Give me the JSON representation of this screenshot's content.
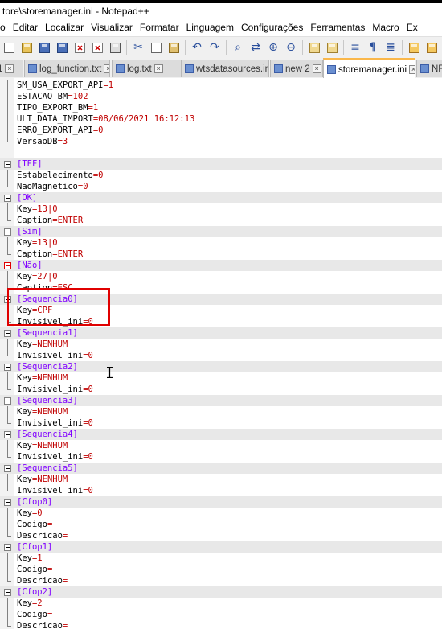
{
  "window": {
    "title": "tore\\storemanager.ini - Notepad++"
  },
  "menu": [
    "o",
    "Editar",
    "Localizar",
    "Visualizar",
    "Formatar",
    "Linguagem",
    "Configurações",
    "Ferramentas",
    "Macro",
    "Ex"
  ],
  "toolbar_icons": [
    "new-file-icon",
    "open-file-icon",
    "save-icon",
    "save-all-icon",
    "close-icon",
    "close-all-icon",
    "print-icon",
    "cut-icon",
    "copy-icon",
    "paste-icon",
    "undo-icon",
    "redo-icon",
    "find-icon",
    "replace-icon",
    "zoom-in-icon",
    "zoom-out-icon",
    "sync-v-icon",
    "sync-h-icon",
    "wrap-icon",
    "all-chars-icon",
    "indent-guide-icon",
    "udl-icon",
    "doc-map-icon",
    "function-list-icon"
  ],
  "tabs": [
    {
      "label": "1",
      "active": false
    },
    {
      "label": "log_function.txt",
      "active": false
    },
    {
      "label": "log.txt",
      "active": false
    },
    {
      "label": "wtsdatasources.ini",
      "active": false
    },
    {
      "label": "new 2",
      "active": false
    },
    {
      "label": "storemanager.ini",
      "active": true
    },
    {
      "label": "NF",
      "active": false
    }
  ],
  "lines": [
    {
      "k": "SM_USA_EXPORT_API",
      "v": "1"
    },
    {
      "k": "ESTACAO_BM",
      "v": "102"
    },
    {
      "k": "TIPO_EXPORT_BM",
      "v": "1"
    },
    {
      "k": "ULT_DATA_IMPORT",
      "v": "08/06/2021 16:12:13"
    },
    {
      "k": "ERRO_EXPORT_API",
      "v": "0"
    },
    {
      "k": "VersaoDB",
      "v": "3",
      "end": true
    },
    {
      "blank": true
    },
    {
      "sec": "[TEF]"
    },
    {
      "k": "Estabelecimento",
      "v": "0"
    },
    {
      "k": "NaoMagnetico",
      "v": "0",
      "end": true
    },
    {
      "sec": "[OK]"
    },
    {
      "k": "Key",
      "v": "13|0"
    },
    {
      "k": "Caption",
      "v": "ENTER",
      "end": true
    },
    {
      "sec": "[Sim]"
    },
    {
      "k": "Key",
      "v": "13|0"
    },
    {
      "k": "Caption",
      "v": "ENTER",
      "end": true
    },
    {
      "sec": "[Não]",
      "red": true
    },
    {
      "k": "Key",
      "v": "27|0"
    },
    {
      "k": "Caption",
      "v": "ESC",
      "end": true
    },
    {
      "sec": "[Sequencia0]"
    },
    {
      "k": "Key",
      "v": "CPF"
    },
    {
      "k": "Invisivel_ini",
      "v": "0",
      "end": true
    },
    {
      "sec": "[Sequencia1]"
    },
    {
      "k": "Key",
      "v": "NENHUM"
    },
    {
      "k": "Invisivel_ini",
      "v": "0",
      "end": true
    },
    {
      "sec": "[Sequencia2]"
    },
    {
      "k": "Key",
      "v": "NENHUM"
    },
    {
      "k": "Invisivel_ini",
      "v": "0",
      "end": true
    },
    {
      "sec": "[Sequencia3]"
    },
    {
      "k": "Key",
      "v": "NENHUM"
    },
    {
      "k": "Invisivel_ini",
      "v": "0",
      "end": true
    },
    {
      "sec": "[Sequencia4]"
    },
    {
      "k": "Key",
      "v": "NENHUM"
    },
    {
      "k": "Invisivel_ini",
      "v": "0",
      "end": true
    },
    {
      "sec": "[Sequencia5]"
    },
    {
      "k": "Key",
      "v": "NENHUM"
    },
    {
      "k": "Invisivel_ini",
      "v": "0",
      "end": true
    },
    {
      "sec": "[Cfop0]"
    },
    {
      "k": "Key",
      "v": "0"
    },
    {
      "k": "Codigo",
      "v": ""
    },
    {
      "k": "Descricao",
      "v": "",
      "end": true
    },
    {
      "sec": "[Cfop1]"
    },
    {
      "k": "Key",
      "v": "1"
    },
    {
      "k": "Codigo",
      "v": ""
    },
    {
      "k": "Descricao",
      "v": "",
      "end": true
    },
    {
      "sec": "[Cfop2]"
    },
    {
      "k": "Key",
      "v": "2"
    },
    {
      "k": "Codigo",
      "v": ""
    },
    {
      "k": "Descricao",
      "v": "",
      "end": true
    }
  ],
  "colors": {
    "section": "#8000ff",
    "value": "#c00000",
    "highlight": "#e00000",
    "active_tab": "#fab74a"
  }
}
